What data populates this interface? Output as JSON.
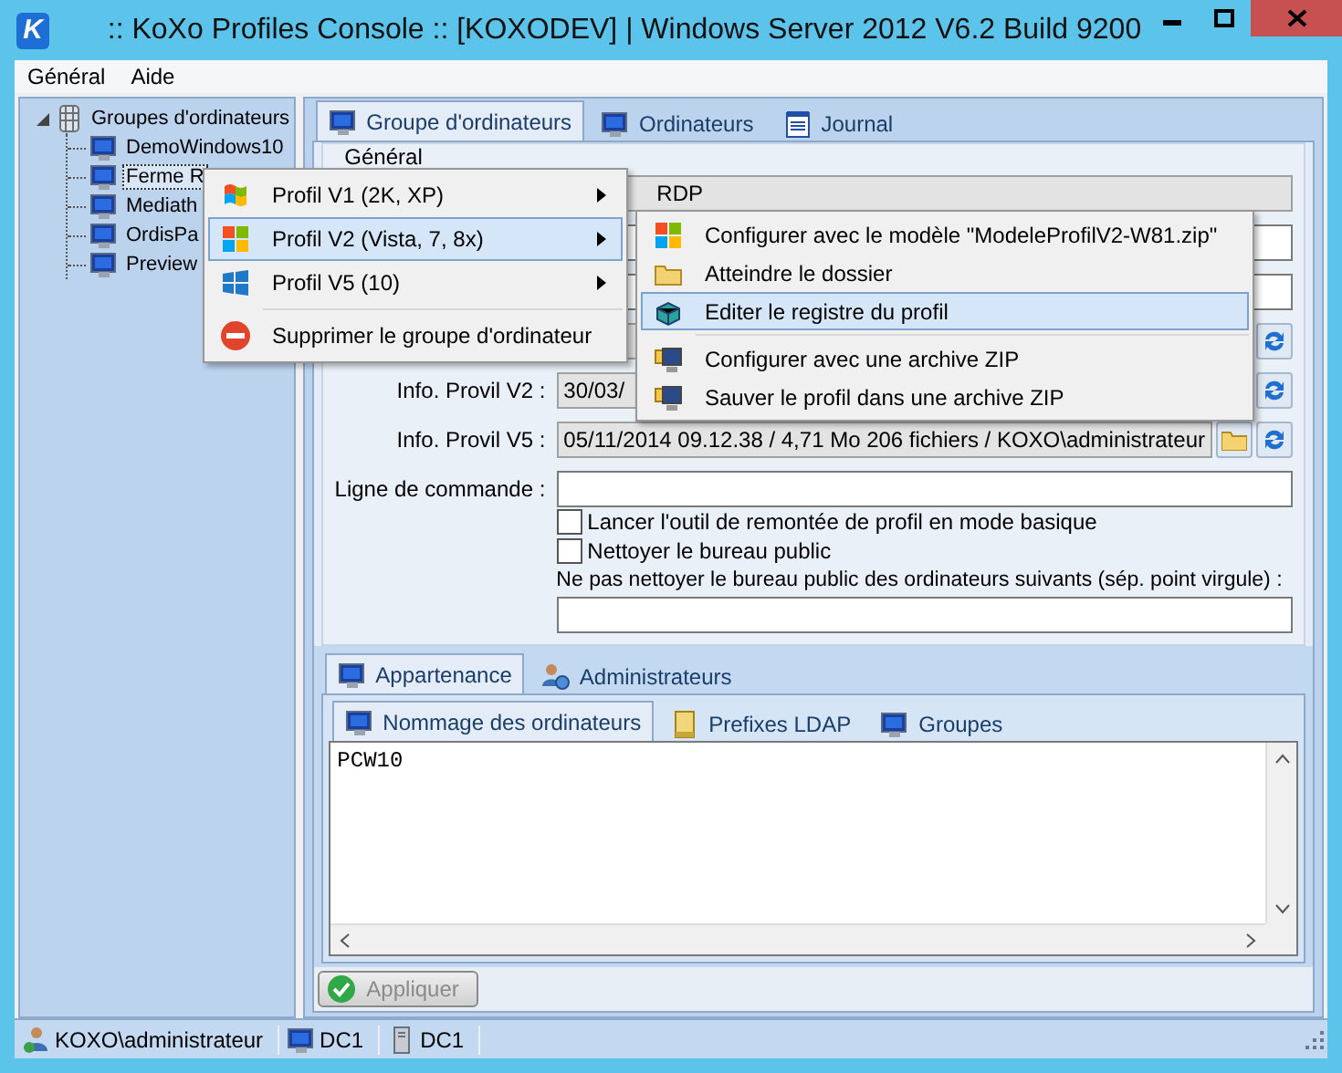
{
  "window": {
    "logo": "K",
    "title": ":: KoXo Profiles Console :: [KOXODEV]  | Windows Server 2012 V6.2 Build 9200"
  },
  "menu": [
    "Général",
    "Aide"
  ],
  "tree": {
    "label": "Groupes d'ordinateurs",
    "expanded": true,
    "children": [
      {
        "label": "DemoWindows10",
        "selected": false
      },
      {
        "label": "Ferme R",
        "selected": true
      },
      {
        "label": "Mediath",
        "selected": false
      },
      {
        "label": "OrdisPa",
        "selected": false
      },
      {
        "label": "Preview",
        "selected": false
      }
    ]
  },
  "tabs": [
    {
      "kind": "computer",
      "label": "Groupe d'ordinateurs",
      "selected": true
    },
    {
      "kind": "computer",
      "label": "Ordinateurs",
      "selected": false
    },
    {
      "kind": "journal",
      "label": "Journal",
      "selected": false
    }
  ],
  "general": {
    "title": "Général",
    "rows": [
      {
        "kind": "info",
        "value": "RDP"
      },
      {
        "kind": "input"
      },
      {
        "kind": "input"
      },
      {
        "kind": "info-buttons"
      },
      {
        "kind": "info-buttons",
        "label": "Info. Provil V2 :",
        "value": "30/03/"
      },
      {
        "kind": "info-buttons",
        "folder_button": true,
        "label": "Info. Provil V5 :",
        "value": "05/11/2014 09.12.38 / 4,71 Mo  206 fichiers /  KOXO\\administrateur"
      },
      {
        "kind": "input",
        "label": "Ligne de commande :"
      }
    ],
    "checkboxes": [
      {
        "label": "Lancer l'outil de remontée de profil en mode basique",
        "checked": false
      },
      {
        "label": "Nettoyer le bureau public",
        "checked": false
      }
    ],
    "exclusion_label": "Ne pas nettoyer le bureau public des ordinateurs suivants (sép. point virgule)  :"
  },
  "lower_tabs": [
    {
      "kind": "computer",
      "label": "Appartenance",
      "selected": true
    },
    {
      "kind": "admin",
      "label": "Administrateurs",
      "selected": false
    }
  ],
  "inner_tabs": [
    {
      "kind": "computer",
      "label": "Nommage des ordinateurs",
      "selected": true
    },
    {
      "kind": "ldap",
      "label": "Prefixes LDAP",
      "selected": false
    },
    {
      "kind": "computer",
      "label": "Groupes",
      "selected": false
    }
  ],
  "naming_text": "PCW10",
  "apply_button": {
    "label": "Appliquer",
    "disabled": true
  },
  "status_bar": [
    {
      "kind": "user",
      "text": "KOXO\\administrateur"
    },
    {
      "kind": "computer",
      "text": "DC1"
    },
    {
      "kind": "server",
      "text": "DC1"
    }
  ],
  "context_menu": [
    {
      "kind": "xp",
      "label": "Profil V1 (2K, XP)",
      "submenu": true,
      "selected": false
    },
    {
      "kind": "win8",
      "label": "Profil V2 (Vista, 7, 8x)",
      "submenu": true,
      "selected": true
    },
    {
      "kind": "win10",
      "label": "Profil V5 (10)",
      "submenu": true,
      "selected": false
    },
    {
      "kind": "separator"
    },
    {
      "kind": "delete",
      "label": "Supprimer le groupe d'ordinateur",
      "submenu": false,
      "selected": false
    }
  ],
  "submenu": [
    {
      "kind": "win8",
      "label": "Configurer avec le modèle \"ModeleProfilV2-W81.zip\"",
      "selected": false
    },
    {
      "kind": "folder",
      "label": "Atteindre le dossier",
      "selected": false
    },
    {
      "kind": "registry",
      "label": "Editer le registre du profil",
      "selected": true
    },
    {
      "kind": "separator"
    },
    {
      "kind": "zip",
      "label": "Configurer avec une archive ZIP",
      "selected": false
    },
    {
      "kind": "zip",
      "label": "Sauver le profil dans une archive ZIP",
      "selected": false
    }
  ]
}
